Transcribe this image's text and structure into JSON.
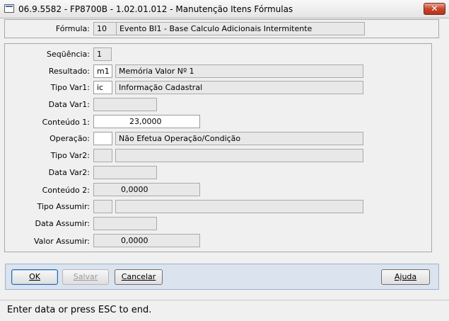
{
  "window": {
    "title": "06.9.5582 - FP8700B - 1.02.01.012 - Manutenção Itens Fórmulas",
    "close_glyph": "✕"
  },
  "formula": {
    "label": "Fórmula:",
    "code": "10",
    "description": "Evento BI1 - Base Calculo Adicionais Intermitente"
  },
  "fields": {
    "sequencia": {
      "label": "Seqüência:",
      "value": "1"
    },
    "resultado": {
      "label": "Resultado:",
      "code": "m1",
      "description": "Memória Valor Nº 1"
    },
    "tipo_var1": {
      "label": "Tipo Var1:",
      "code": "ic",
      "description": "Informação Cadastral"
    },
    "data_var1": {
      "label": "Data Var1:",
      "value": ""
    },
    "conteudo1": {
      "label": "Conteúdo 1:",
      "value": "23,0000"
    },
    "operacao": {
      "label": "Operação:",
      "code": "",
      "description": "Não Efetua Operação/Condição"
    },
    "tipo_var2": {
      "label": "Tipo Var2:",
      "code": "",
      "description": ""
    },
    "data_var2": {
      "label": "Data Var2:",
      "value": ""
    },
    "conteudo2": {
      "label": "Conteúdo 2:",
      "value": "0,0000"
    },
    "tipo_assumir": {
      "label": "Tipo Assumir:",
      "code": "",
      "description": ""
    },
    "data_assumir": {
      "label": "Data Assumir:",
      "value": ""
    },
    "valor_assumir": {
      "label": "Valor Assumir:",
      "value": "0,0000"
    }
  },
  "buttons": {
    "ok": "OK",
    "salvar": "Salvar",
    "cancelar": "Cancelar",
    "ajuda": "Ajuda"
  },
  "status": "Enter data or press ESC to end."
}
